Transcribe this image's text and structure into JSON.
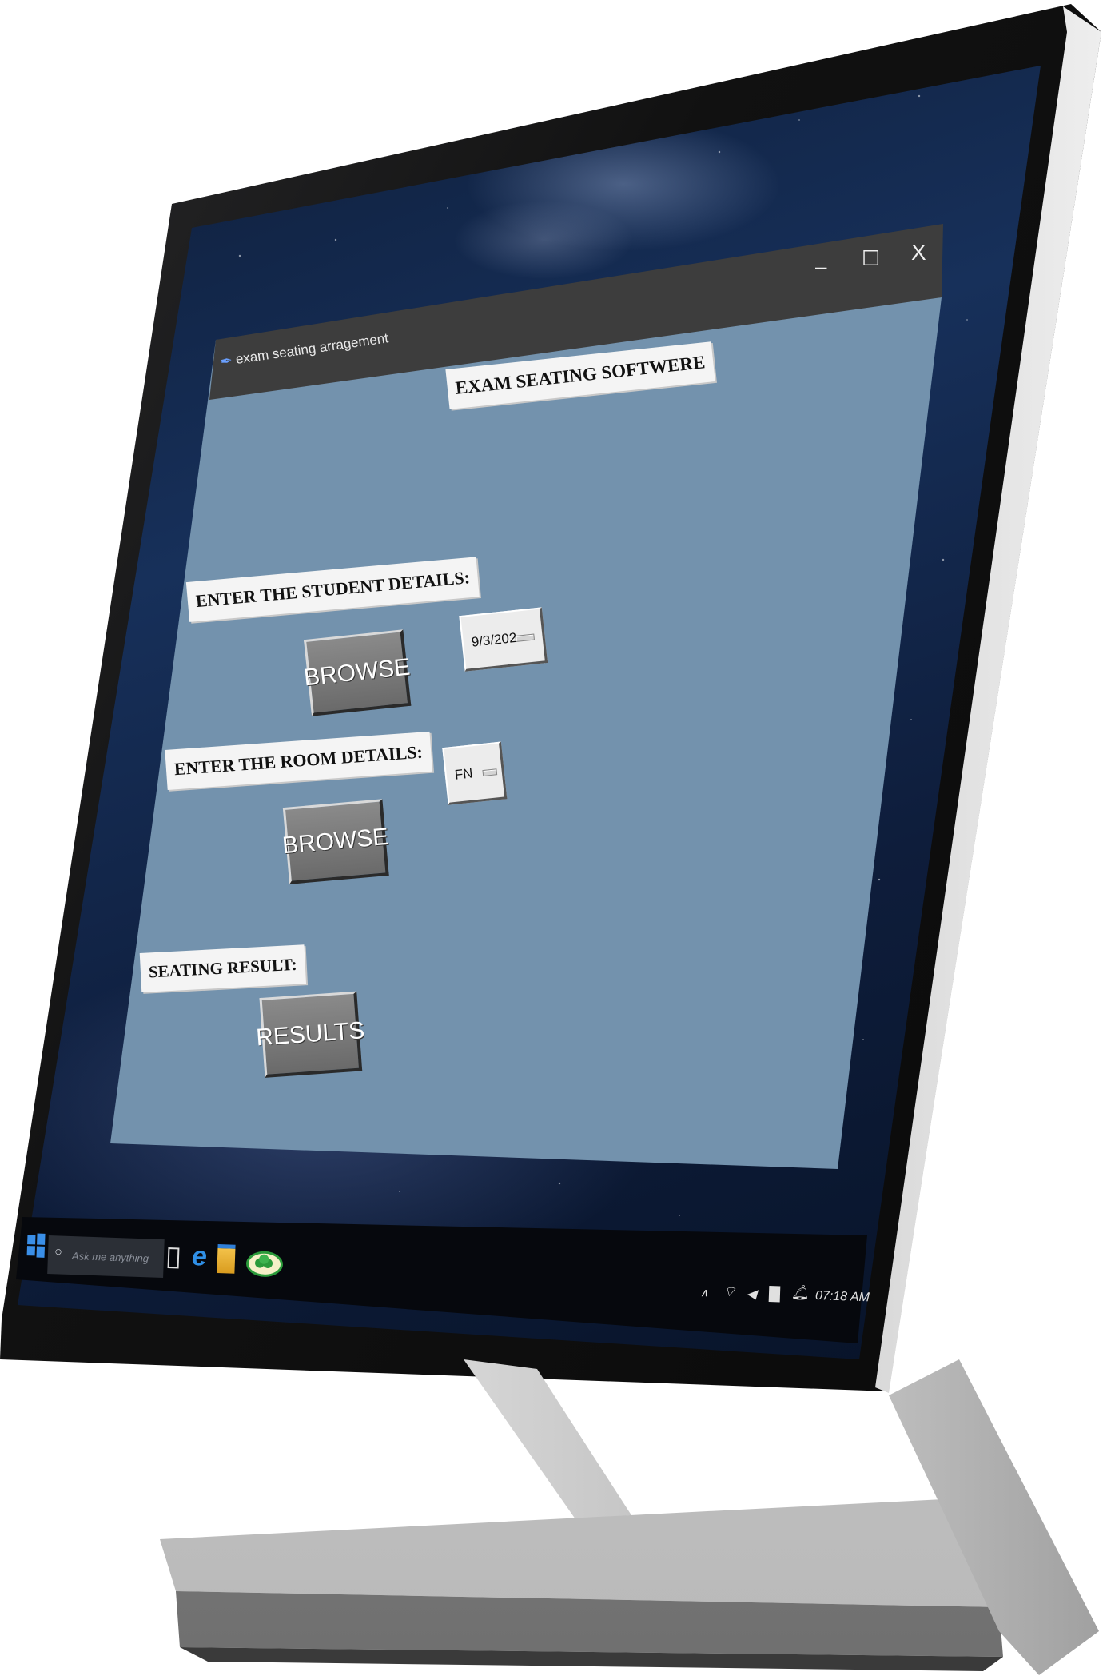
{
  "window": {
    "title": "exam seating arragement",
    "controls": {
      "minimize": "–",
      "maximize": "☐",
      "close": "X"
    }
  },
  "app": {
    "heading": "EXAM SEATING SOFTWERE",
    "student_label": "ENTER THE STUDENT DETAILS:",
    "student_browse": "BROWSE",
    "room_label": "ENTER THE ROOM DETAILS:",
    "room_browse": "BROWSE",
    "result_label": "SEATING RESULT:",
    "results_button": "RESULTS",
    "date_select": "9/3/202",
    "session_select": "FN"
  },
  "taskbar": {
    "search_placeholder": "Ask me anything",
    "clock": "07:18 AM",
    "icons": [
      "windows-start-icon",
      "cortana-icon",
      "task-view-icon",
      "edge-icon",
      "file-explorer-icon",
      "app-logo-icon"
    ],
    "tray_icons": [
      "chevron-up-icon",
      "wifi-icon",
      "volume-icon",
      "battery-icon",
      "notification-icon"
    ]
  },
  "colors": {
    "app_background": "#7392ad",
    "titlebar": "#3d3d3d",
    "button": "#7a7a7a",
    "label_box": "#f4f4f4"
  }
}
